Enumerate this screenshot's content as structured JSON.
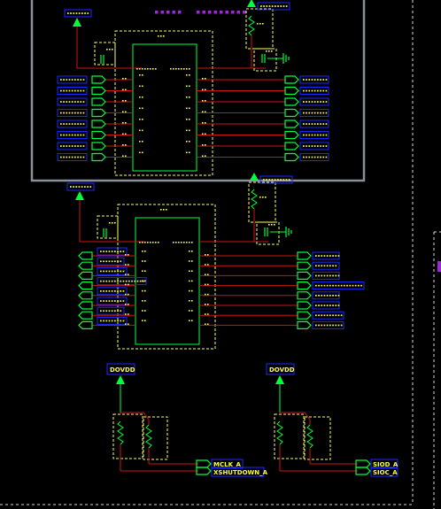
{
  "schematic": {
    "colors": {
      "background": "#000000",
      "wire": "#cc1414",
      "component": "#00ff3c",
      "label_text": "#ffff40",
      "label_box": "#1a2aff",
      "selection_box": "#ffff66",
      "sheet_border": "#8a8f99",
      "bus_dots": "#9a2bd1",
      "dashed_border": "#d8d8d8"
    },
    "labels": {
      "dovdd_left": "DOVDD",
      "dovdd_right": "DOVDD",
      "mclk": "MCLK_A",
      "xshutdown": "XSHUTDOWN_A",
      "siod": "SIOD_A",
      "sioc": "SIOC_A"
    },
    "icons": {
      "power_arrow": "up-arrow-icon",
      "ground": "ground-icon",
      "resistor": "resistor-icon",
      "capacitor": "capacitor-icon",
      "port": "port-icon"
    }
  }
}
